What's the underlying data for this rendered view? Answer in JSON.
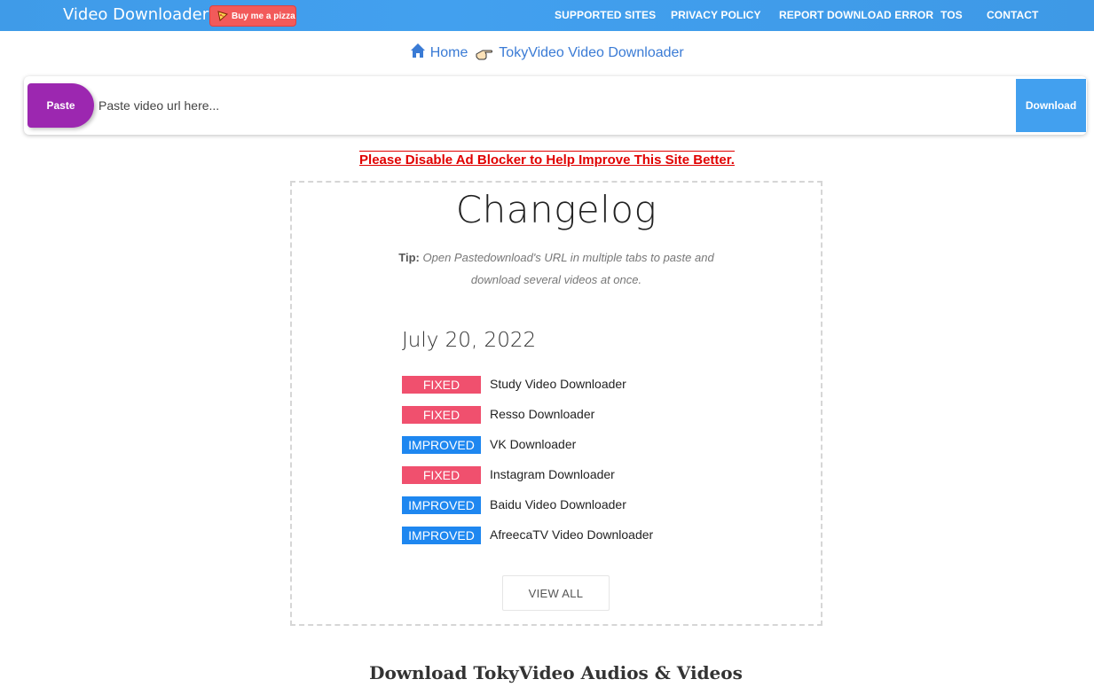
{
  "navbar": {
    "brand": "Video Downloader",
    "pizza_label": "Buy me a pizza",
    "links": [
      "SUPPORTED SITES",
      "PRIVACY POLICY",
      "REPORT DOWNLOAD ERROR",
      "TOS",
      "CONTACT"
    ]
  },
  "breadcrumb": {
    "home": "Home",
    "current": "TokyVideo Video Downloader"
  },
  "search": {
    "paste_label": "Paste",
    "placeholder": "Paste video url here...",
    "download_label": "Download"
  },
  "ad_notice": "Please Disable Ad Blocker to Help Improve This Site Better.",
  "changelog": {
    "title": "Changelog",
    "tip_label": "Tip:",
    "tip_text": "Open Pastedownload's URL in multiple tabs to paste and download several videos at once.",
    "date": "July 20, 2022",
    "entries": [
      {
        "status": "FIXED",
        "text": "Study Video Downloader"
      },
      {
        "status": "FIXED",
        "text": "Resso Downloader"
      },
      {
        "status": "IMPROVED",
        "text": "VK Downloader"
      },
      {
        "status": "FIXED",
        "text": "Instagram Downloader"
      },
      {
        "status": "IMPROVED",
        "text": "Baidu Video Downloader"
      },
      {
        "status": "IMPROVED",
        "text": "AfreecaTV Video Downloader"
      }
    ],
    "view_all": "VIEW ALL"
  },
  "section_heading": "Download TokyVideo Audios & Videos",
  "colors": {
    "navbar": "#42a0ef",
    "paste": "#9c27b0",
    "fixed": "#f0506e",
    "improved": "#1e87f0",
    "ad_notice": "#e00000"
  }
}
